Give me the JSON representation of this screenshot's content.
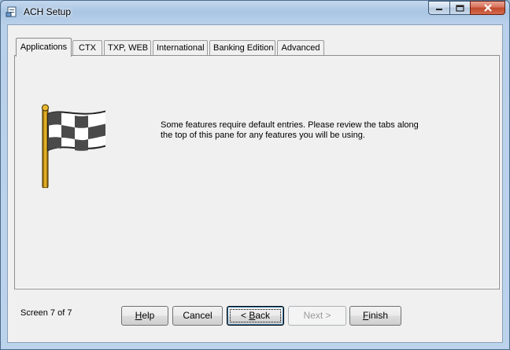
{
  "window": {
    "title": "ACH Setup",
    "icon": "app-document-icon",
    "controls": [
      "minimize-icon",
      "maximize-icon",
      "close-icon"
    ]
  },
  "tabs": [
    {
      "label": "Applications",
      "active": true
    },
    {
      "label": "CTX",
      "active": false
    },
    {
      "label": "TXP, WEB",
      "active": false
    },
    {
      "label": "International",
      "active": false
    },
    {
      "label": "Banking Edition",
      "active": false
    },
    {
      "label": "Advanced",
      "active": false
    }
  ],
  "panel": {
    "icon": "checkered-flag-icon",
    "message": "Some features require default entries.  Please review the tabs along the top of this pane for any features you will be using."
  },
  "footer": {
    "screen_label": "Screen 7 of 7",
    "buttons": {
      "help": {
        "first": "H",
        "rest": "elp"
      },
      "cancel": "Cancel",
      "back": {
        "pre": "< ",
        "first": "B",
        "rest": "ack"
      },
      "next": "Next >",
      "finish": {
        "first": "F",
        "rest": "inish"
      }
    }
  }
}
